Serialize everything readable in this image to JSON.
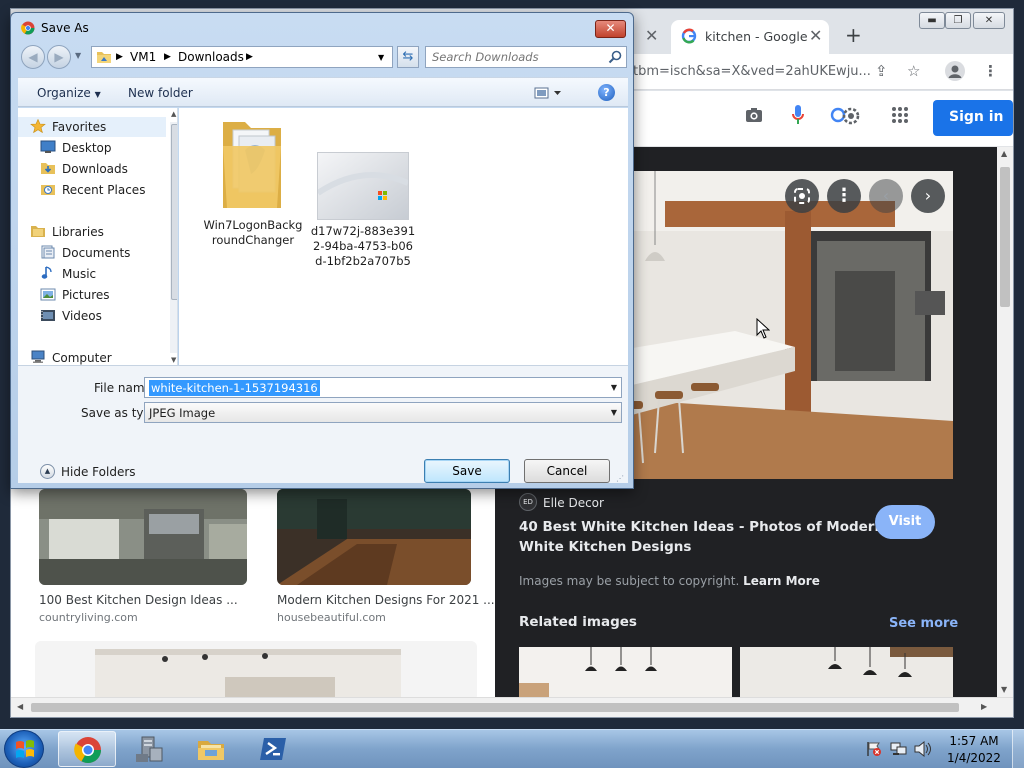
{
  "browser": {
    "tabs": [
      {
        "title": "kitchen - Google"
      }
    ],
    "url": "tbm=isch&sa=X&ved=2ahUKEwju...",
    "signin_label": "Sign in"
  },
  "results": [
    {
      "caption": "100 Best Kitchen Design Ideas ...",
      "site": "countryliving.com"
    },
    {
      "caption": "Modern Kitchen Designs For 2021 ...",
      "site": "housebeautiful.com"
    }
  ],
  "viewer": {
    "source_badge": "ED",
    "source": "Elle Decor",
    "title_line1": "40 Best White Kitchen Ideas - Photos of Modern",
    "title_line2": "White Kitchen Designs",
    "visit_label": "Visit",
    "copyright_text": "Images may be subject to copyright.",
    "learn_more": "Learn More",
    "related_title": "Related images",
    "see_more": "See more"
  },
  "dialog": {
    "title": "Save As",
    "breadcrumb": [
      "VM1",
      "Downloads"
    ],
    "search_placeholder": "Search Downloads",
    "organize_label": "Organize",
    "new_folder_label": "New folder",
    "nav": {
      "favorites": "Favorites",
      "desktop": "Desktop",
      "downloads": "Downloads",
      "recent_places": "Recent Places",
      "libraries": "Libraries",
      "documents": "Documents",
      "music": "Music",
      "pictures": "Pictures",
      "videos": "Videos",
      "computer": "Computer"
    },
    "files": [
      {
        "name_line1": "Win7LogonBackg",
        "name_line2": "roundChanger"
      },
      {
        "name_line1": "d17w72j-883e391",
        "name_line2": "2-94ba-4753-b06",
        "name_line3": "d-1bf2b2a707b5"
      }
    ],
    "file_name_label": "File name:",
    "file_name_value": "white-kitchen-1-1537194316",
    "save_type_label": "Save as type:",
    "save_type_value": "JPEG Image",
    "hide_folders_label": "Hide Folders",
    "save_label": "Save",
    "cancel_label": "Cancel"
  },
  "taskbar": {
    "time": "1:57 AM",
    "date": "1/4/2022"
  },
  "colors": {
    "google_blue": "#1a73e8",
    "viewer_bg": "#202124",
    "dialog_frame": "#b5cde8",
    "selection": "#3399ff"
  }
}
